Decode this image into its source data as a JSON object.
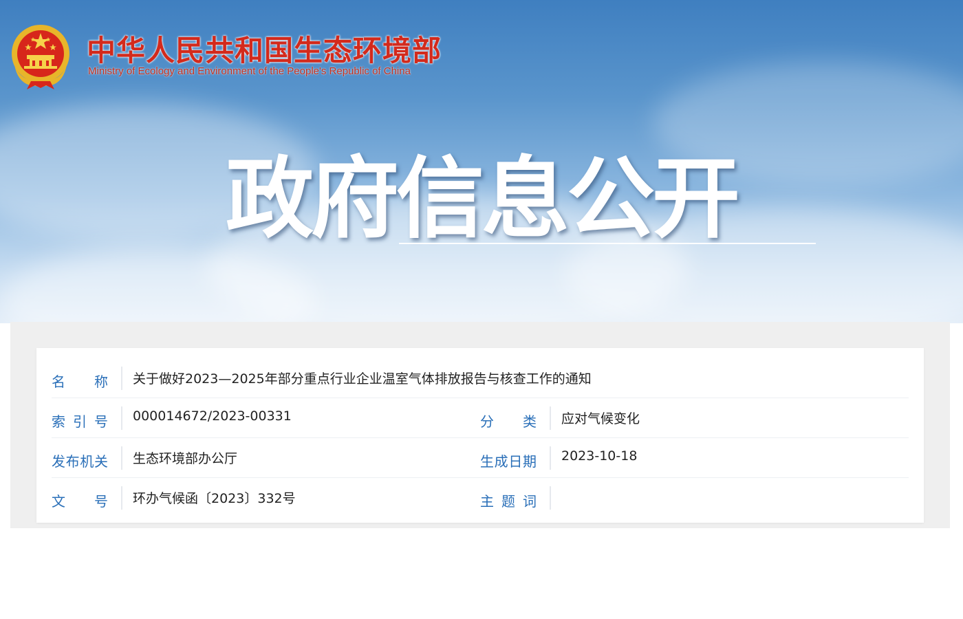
{
  "header": {
    "site_name_cn": "中华人民共和国生态环境部",
    "site_name_en": "Ministry of Ecology and Environment of the People's Republic of China",
    "banner_title": "政府信息公开"
  },
  "info": {
    "name_label": "名　称",
    "name_value": "关于做好2023—2025年部分重点行业企业温室气体排放报告与核查工作的通知",
    "index_label": "索引号",
    "index_value": "000014672/2023-00331",
    "category_label": "分　类",
    "category_value": "应对气候变化",
    "issuer_label": "发布机关",
    "issuer_value": "生态环境部办公厅",
    "date_label": "生成日期",
    "date_value": "2023-10-18",
    "docno_label": "文　号",
    "docno_value": "环办气候函〔2023〕332号",
    "keywords_label": "主题词",
    "keywords_value": ""
  },
  "colors": {
    "label_blue": "#2a6fb8",
    "title_red": "#d32a1c"
  },
  "icons": {
    "emblem": "national-emblem-icon"
  }
}
